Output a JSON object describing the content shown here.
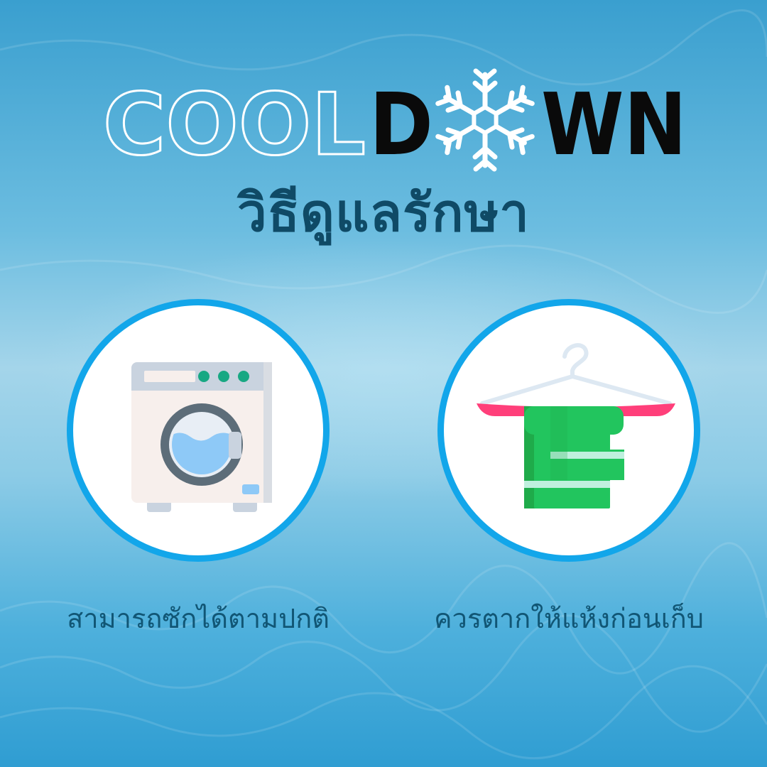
{
  "brand": {
    "outline_text": "COOL",
    "bold_start": "D",
    "bold_end": "WN",
    "outline_color": "#ffffff",
    "bold_color": "#0a0a0a",
    "snowflake_color": "#ffffff"
  },
  "subtitle": "วิธีดูแลรักษา",
  "care_items": [
    {
      "icon": "washing-machine-icon",
      "caption": "สามารถซักได้ตามปกติ"
    },
    {
      "icon": "towel-on-hanger-icon",
      "caption": "ควรตากให้แห้งก่อนเก็บ"
    }
  ],
  "colors": {
    "ring": "#12a6ea",
    "subtitle": "#0f4a66",
    "caption": "#115675",
    "towel": "#22c55e",
    "hanger_bar": "#ff3f7a"
  }
}
